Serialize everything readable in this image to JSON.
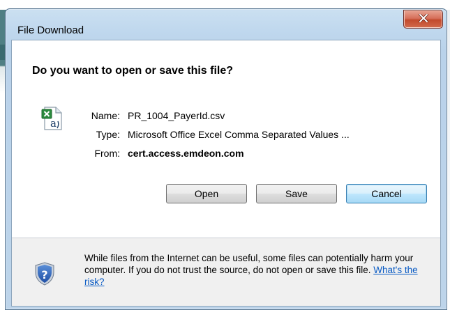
{
  "dialog": {
    "title": "File Download",
    "question": "Do you want to open or save this file?",
    "file": {
      "name_label": "Name:",
      "name_value": "PR_1004_PayerId.csv",
      "type_label": "Type:",
      "type_value": "Microsoft Office Excel Comma Separated Values ...",
      "from_label": "From:",
      "from_value": "cert.access.emdeon.com"
    },
    "buttons": {
      "open": "Open",
      "save": "Save",
      "cancel": "Cancel"
    },
    "warning": {
      "text": "While files from the Internet can be useful, some files can potentially harm your computer. If you do not trust the source, do not open or save this file.",
      "link": "What's the risk?"
    }
  },
  "icons": {
    "file": "excel-csv-file-icon",
    "shield": "security-shield-icon",
    "close": "close-icon"
  },
  "colors": {
    "title_bar": "#bfd6ec",
    "close_button": "#c9563a",
    "link": "#0a5bc4",
    "default_button_border": "#3c7fb1"
  }
}
